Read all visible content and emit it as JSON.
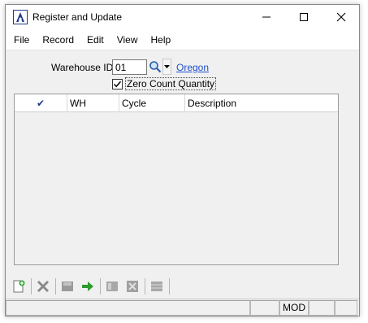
{
  "window": {
    "title": "Register and Update"
  },
  "menu": {
    "items": [
      "File",
      "Record",
      "Edit",
      "View",
      "Help"
    ]
  },
  "form": {
    "warehouse_label": "Warehouse ID:",
    "warehouse_value": "01",
    "warehouse_desc": "Oregon",
    "zero_count_label": "Zero Count Quantity",
    "zero_count_checked": true
  },
  "grid": {
    "columns": [
      "✔",
      "WH",
      "Cycle",
      "Description"
    ],
    "rows": []
  },
  "toolbar": {
    "buttons": [
      "new-icon",
      "delete-icon",
      "save-icon",
      "proceed-icon",
      "first-icon",
      "expand-icon",
      "grid-icon"
    ]
  },
  "status": {
    "mode": "MOD"
  },
  "colors": {
    "link": "#1f4fcc",
    "accent": "#1f3a8a",
    "proceed_green": "#2e9a2e"
  }
}
